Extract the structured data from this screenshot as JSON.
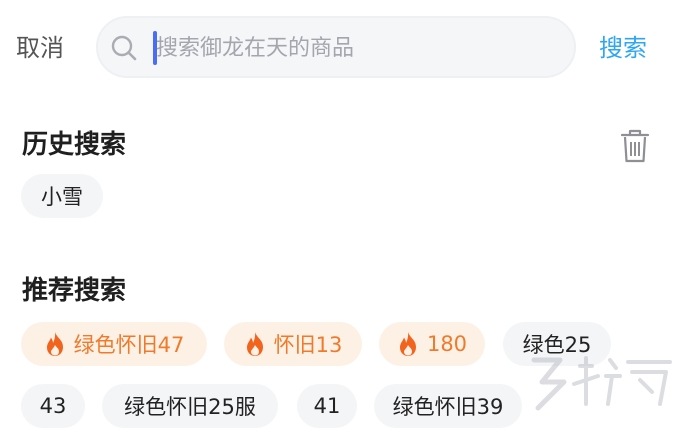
{
  "header": {
    "cancel_label": "取消",
    "search_placeholder": "搜索御龙在天的商品",
    "search_label": "搜索"
  },
  "history": {
    "title": "历史搜索",
    "items": [
      "小雪"
    ]
  },
  "recommend": {
    "title": "推荐搜索",
    "hot_items": [
      "绿色怀旧47",
      "怀旧13",
      "180"
    ],
    "items": [
      "绿色25",
      "43",
      "绿色怀旧25服",
      "41",
      "绿色怀旧39"
    ]
  },
  "colors": {
    "accent": "#2ea6f2",
    "hot_text": "#f07a2b",
    "hot_bg": "#fdf1e6",
    "chip_bg": "#f4f5f7"
  },
  "icons": [
    "search-icon",
    "trash-icon",
    "fire-icon"
  ]
}
